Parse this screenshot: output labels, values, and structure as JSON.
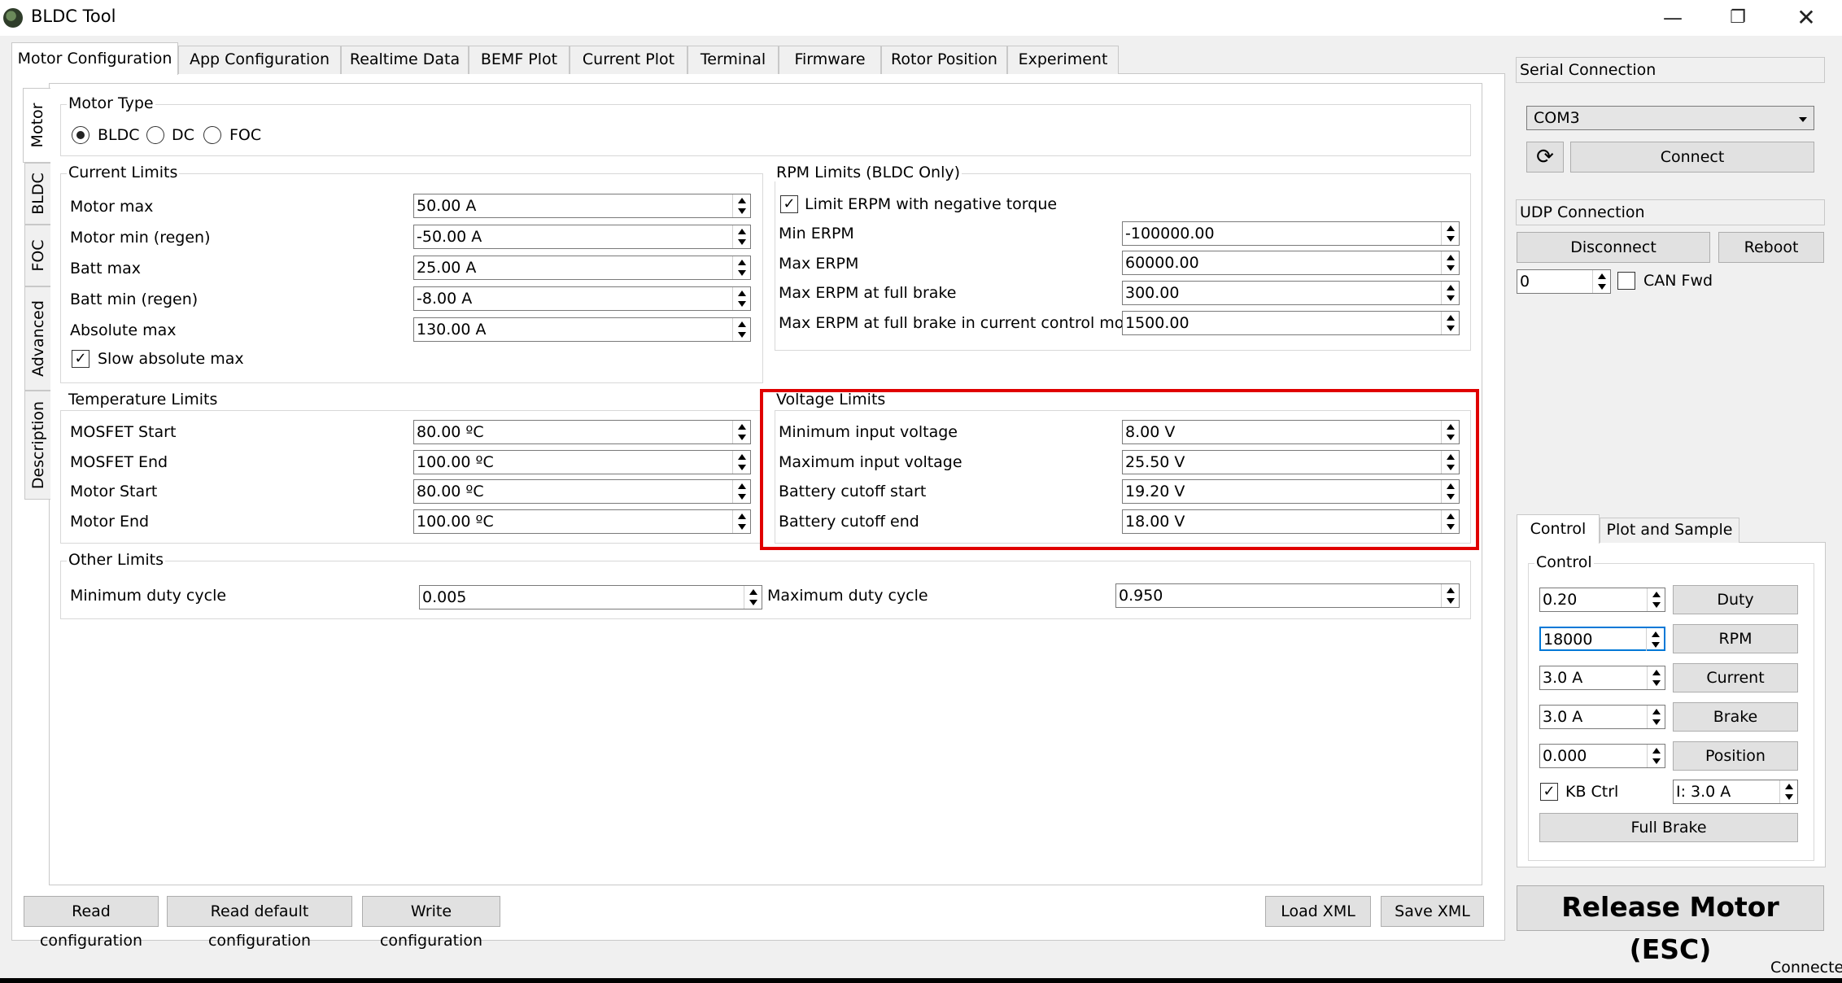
{
  "window": {
    "title": "BLDC Tool"
  },
  "main_tabs": [
    "Motor Configuration",
    "App Configuration",
    "Realtime Data",
    "BEMF Plot",
    "Current Plot",
    "Terminal",
    "Firmware",
    "Rotor Position",
    "Experiment"
  ],
  "side_tabs": [
    "Motor",
    "BLDC",
    "FOC",
    "Advanced",
    "Description"
  ],
  "motor_type": {
    "title": "Motor Type",
    "options": [
      "BLDC",
      "DC",
      "FOC"
    ],
    "selected": "BLDC"
  },
  "current_limits": {
    "title": "Current Limits",
    "rows": [
      {
        "label": "Motor max",
        "value": "50.00 A"
      },
      {
        "label": "Motor min (regen)",
        "value": "-50.00 A"
      },
      {
        "label": "Batt max",
        "value": "25.00 A"
      },
      {
        "label": "Batt min (regen)",
        "value": "-8.00 A"
      },
      {
        "label": "Absolute max",
        "value": "130.00 A"
      }
    ],
    "slow_abs_label": "Slow absolute max"
  },
  "rpm_limits": {
    "title": "RPM Limits (BLDC Only)",
    "neg_torque_label": "Limit ERPM with negative torque",
    "rows": [
      {
        "label": "Min ERPM",
        "value": "-100000.00"
      },
      {
        "label": "Max ERPM",
        "value": "60000.00"
      },
      {
        "label": "Max ERPM at full brake",
        "value": "300.00"
      },
      {
        "label": "Max ERPM at full brake in current control mode",
        "value": "1500.00"
      }
    ]
  },
  "temp_limits": {
    "title": "Temperature Limits",
    "rows": [
      {
        "label": "MOSFET Start",
        "value": "80.00 ºC"
      },
      {
        "label": "MOSFET End",
        "value": "100.00 ºC"
      },
      {
        "label": "Motor Start",
        "value": "80.00 ºC"
      },
      {
        "label": "Motor End",
        "value": "100.00 ºC"
      }
    ]
  },
  "voltage_limits": {
    "title": "Voltage Limits",
    "rows": [
      {
        "label": "Minimum input voltage",
        "value": "8.00 V"
      },
      {
        "label": "Maximum input voltage",
        "value": "25.50 V"
      },
      {
        "label": "Battery cutoff start",
        "value": "19.20 V"
      },
      {
        "label": "Battery cutoff end",
        "value": "18.00 V"
      }
    ]
  },
  "other_limits": {
    "title": "Other Limits",
    "min_duty_label": "Minimum duty cycle",
    "min_duty_value": "0.005",
    "max_duty_label": "Maximum duty cycle",
    "max_duty_value": "0.950"
  },
  "bottom_buttons": {
    "read_config": "Read configuration",
    "read_default": "Read default configuration",
    "write_config": "Write configuration",
    "load_xml": "Load XML",
    "save_xml": "Save XML"
  },
  "serial": {
    "title": "Serial Connection",
    "port": "COM3",
    "connect": "Connect"
  },
  "udp": {
    "title": "UDP Connection",
    "disconnect": "Disconnect",
    "reboot": "Reboot",
    "can_id": "0",
    "can_fwd": "CAN Fwd"
  },
  "control_tabs": [
    "Control",
    "Plot and Sample"
  ],
  "control": {
    "group_title": "Control",
    "rows": [
      {
        "value": "0.20",
        "button": "Duty"
      },
      {
        "value": "18000",
        "button": "RPM"
      },
      {
        "value": "3.0 A",
        "button": "Current"
      },
      {
        "value": "3.0 A",
        "button": "Brake"
      },
      {
        "value": "0.000",
        "button": "Position"
      }
    ],
    "kb_ctrl": "KB Ctrl",
    "kb_current": "I: 3.0 A",
    "full_brake": "Full Brake"
  },
  "release_motor": "Release Motor (ESC)",
  "status": "Connected"
}
